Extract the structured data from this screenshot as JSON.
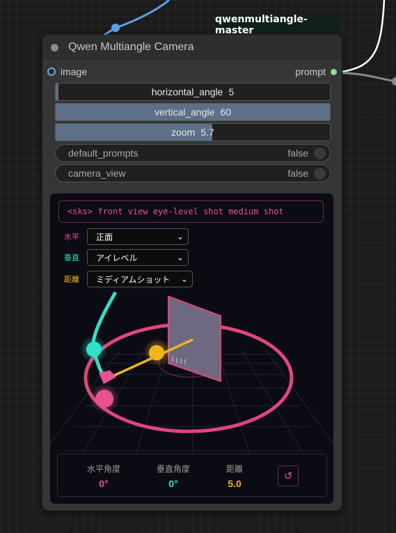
{
  "badge": {
    "label": "qwenmultiangle-master"
  },
  "node": {
    "title": "Qwen Multiangle Camera",
    "input_label": "image",
    "output_label": "prompt",
    "widgets": [
      {
        "label": "horizontal_angle",
        "value": "5",
        "fill_fraction": 0.01
      },
      {
        "label": "vertical_angle",
        "value": "60",
        "fill_fraction": 1.0
      },
      {
        "label": "zoom",
        "value": "5.7",
        "fill_fraction": 0.57
      }
    ],
    "toggles": [
      {
        "label": "default_prompts",
        "value": "false"
      },
      {
        "label": "camera_view",
        "value": "false"
      }
    ]
  },
  "panel": {
    "prompt_text": "<sks> front view eye-level shot medium shot",
    "selects": [
      {
        "label": "水平",
        "value": "正面",
        "color": "#e8528f"
      },
      {
        "label": "垂直",
        "value": "アイレベル",
        "color": "#2fe0c6"
      },
      {
        "label": "距離",
        "value": "ミディアムショット",
        "color": "#f5b31b"
      }
    ],
    "stats": [
      {
        "label": "水平角度",
        "value": "0°",
        "color": "#e8528f"
      },
      {
        "label": "垂直角度",
        "value": "0°",
        "color": "#2fe0c6"
      },
      {
        "label": "距離",
        "value": "5.0",
        "color": "#f5b31b"
      }
    ],
    "reset_icon": "reset-icon"
  },
  "colors": {
    "pink": "#e8528f",
    "teal": "#2fe0c6",
    "gold": "#f5b31b",
    "slider_fill": "#5d7088",
    "wire_blue": "#5aa0e8"
  }
}
